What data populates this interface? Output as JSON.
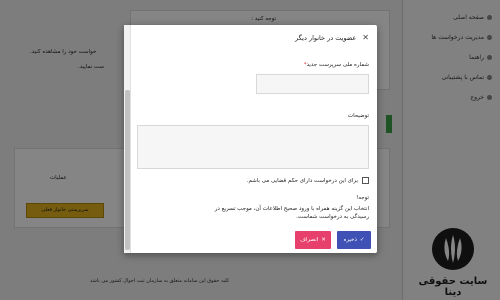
{
  "sidebar": {
    "items": [
      {
        "label": "صفحه اصلی",
        "icon": "home-icon"
      },
      {
        "label": "مدیریت درخواست ها",
        "icon": "list-icon"
      },
      {
        "label": "راهنما",
        "icon": "help-icon"
      },
      {
        "label": "تماس با پشتیبانی",
        "icon": "phone-icon"
      },
      {
        "label": "خروج",
        "icon": "exit-icon"
      }
    ]
  },
  "background": {
    "notice_title": "توجه کنید :",
    "line1": "خواست خود را مشاهده کنید.",
    "line2": "ست نمایید.",
    "table_header": "عملیات",
    "yellow_button": "سرپرستی خانوار فعلی",
    "footer": "کلیه حقوق این سامانه متعلق به سازمان ثبت احوال کشور می باشد"
  },
  "logo": {
    "text": "سایت حقوقی دینا"
  },
  "modal": {
    "title": "عضویت در خانوار دیگر",
    "close": "✕",
    "national_code_label": "شماره ملی سرپرست جدید",
    "required_mark": "*",
    "description_label": "توضیحات",
    "checkbox_label": "برای این درخواست دارای حکم قضایی می باشم.",
    "note_title": "توجه!",
    "note_text": "انتخاب این گزینه همراه با ورود صحیح اطلاعات آن، موجب تسریع در رسیدگی به درخواست شماست.",
    "save_label": "ذخیره",
    "save_icon": "✓",
    "cancel_label": "انصراف",
    "cancel_icon": "✕"
  },
  "colors": {
    "save": "#3f51b5",
    "cancel": "#e8406d",
    "yellow": "#e3b11c"
  }
}
